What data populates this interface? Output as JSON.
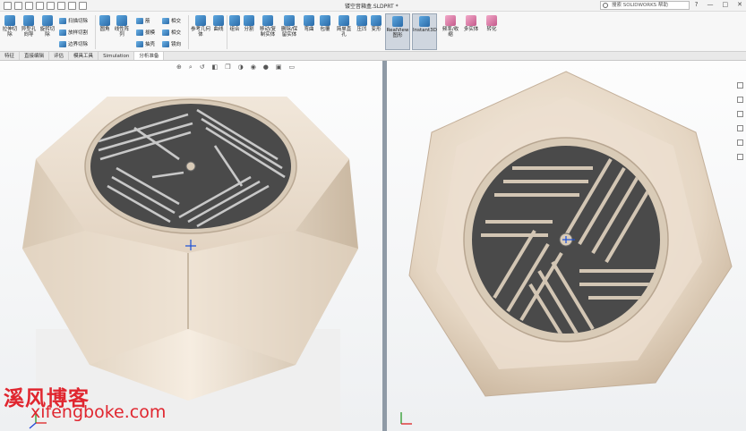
{
  "title": {
    "document": "镂空音箱盒.SLDPRT *"
  },
  "search": {
    "placeholder": "搜索 SOLIDWORKS 帮助"
  },
  "window_controls": [
    "?",
    "—",
    "□",
    "✕"
  ],
  "ribbon": {
    "big_buttons": [
      "拉伸切除",
      "异型孔向导",
      "旋转切除",
      "圆角",
      "线性阵列",
      "参考几何体",
      "曲线",
      "组合",
      "分割",
      "移动/复制实体",
      "删除/保留实体",
      "弯曲",
      "包覆",
      "简单直孔",
      "压凹",
      "变形",
      "RealView 图形",
      "Instant3D",
      "频率/收缩",
      "多实体",
      "转化"
    ],
    "small_buttons": [
      "扫描切除",
      "放样切割",
      "边界切除",
      "筋",
      "拔模",
      "抽壳",
      "相交",
      "镜向"
    ],
    "realview": "RealView 图形",
    "instant3d": "Instant3D"
  },
  "tabs": [
    "特征",
    "直接编辑",
    "评估",
    "模具工具",
    "Simulation",
    "分析准备"
  ],
  "active_tab": "分析准备",
  "watermark": {
    "cn": "溪风博客",
    "url": "xifengboke.com"
  },
  "colors": {
    "part": "#e9dccb",
    "grille": "#4a4a4a",
    "accent": "#2a6aa8",
    "watermark": "#e0262f"
  }
}
